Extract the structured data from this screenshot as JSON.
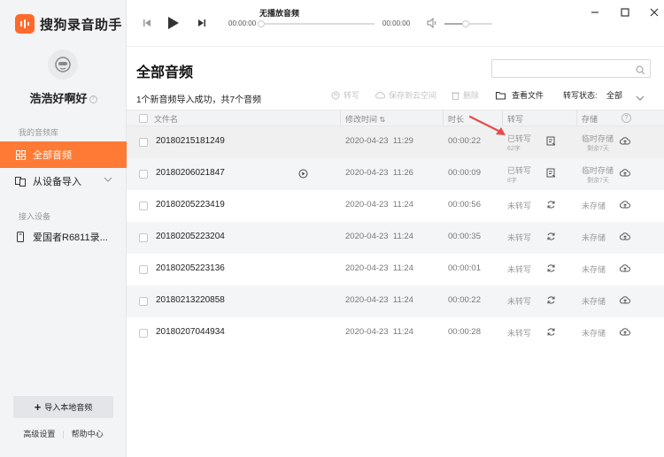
{
  "app": {
    "name": "搜狗录音助手",
    "brand_color": "#ff6a2b",
    "accent_color": "#ff7a35"
  },
  "user": {
    "name": "浩浩好啊好",
    "info_glyph": "?"
  },
  "sidebar": {
    "library_label": "我的音频库",
    "items": [
      {
        "label": "全部音频",
        "icon": "grid-icon",
        "active": true
      },
      {
        "label": "从设备导入",
        "icon": "device-import-icon",
        "active": false
      }
    ],
    "devices_label": "接入设备",
    "devices": [
      {
        "label": "爱国者R6811录..."
      }
    ],
    "import_button": "导入本地音频",
    "bottom_links": [
      "高级设置",
      "帮助中心"
    ]
  },
  "player": {
    "now_playing": "无播放音频",
    "current_time": "00:00:00",
    "total_time": "00:00:00",
    "progress": 0,
    "volume": 0.45
  },
  "main": {
    "title": "全部音频",
    "search_placeholder": "",
    "summary": "1个新音频导入成功，共7个音频",
    "toolbar": {
      "transcribe": "转写",
      "save_cloud": "保存到云空间",
      "delete": "删除",
      "view_file": "查看文件",
      "filter_label": "转写状态:",
      "filter_value": "全部"
    },
    "columns": {
      "filename": "文件名",
      "modified": "修改时间",
      "sort_glyph": "⇅",
      "duration": "时长",
      "transcribe": "转写",
      "storage": "存储",
      "help_glyph": "?"
    },
    "rows": [
      {
        "filename": "20180215181249",
        "date": "2020-04-23",
        "time": "11:29",
        "duration": "00:00:22",
        "transcribe_status": "已转写",
        "transcribe_sub": "62字",
        "storage_status": "临时存储",
        "storage_sub": "剩余7天",
        "playing_icon": false
      },
      {
        "filename": "20180206021847",
        "date": "2020-04-23",
        "time": "11:26",
        "duration": "00:00:09",
        "transcribe_status": "已转写",
        "transcribe_sub": "8字",
        "storage_status": "临时存储",
        "storage_sub": "剩余7天",
        "playing_icon": true
      },
      {
        "filename": "20180205223419",
        "date": "2020-04-23",
        "time": "11:24",
        "duration": "00:00:56",
        "transcribe_status": "未转写",
        "transcribe_sub": "",
        "storage_status": "未存储",
        "storage_sub": "",
        "playing_icon": false
      },
      {
        "filename": "20180205223204",
        "date": "2020-04-23",
        "time": "11:24",
        "duration": "00:00:35",
        "transcribe_status": "未转写",
        "transcribe_sub": "",
        "storage_status": "未存储",
        "storage_sub": "",
        "playing_icon": false
      },
      {
        "filename": "20180205223136",
        "date": "2020-04-23",
        "time": "11:24",
        "duration": "00:00:01",
        "transcribe_status": "未转写",
        "transcribe_sub": "",
        "storage_status": "未存储",
        "storage_sub": "",
        "playing_icon": false
      },
      {
        "filename": "20180213220858",
        "date": "2020-04-23",
        "time": "11:24",
        "duration": "00:00:22",
        "transcribe_status": "未转写",
        "transcribe_sub": "",
        "storage_status": "未存储",
        "storage_sub": "",
        "playing_icon": false
      },
      {
        "filename": "20180207044934",
        "date": "2020-04-23",
        "time": "11:24",
        "duration": "00:00:28",
        "transcribe_status": "未转写",
        "transcribe_sub": "",
        "storage_status": "未存储",
        "storage_sub": "",
        "playing_icon": false
      }
    ]
  }
}
